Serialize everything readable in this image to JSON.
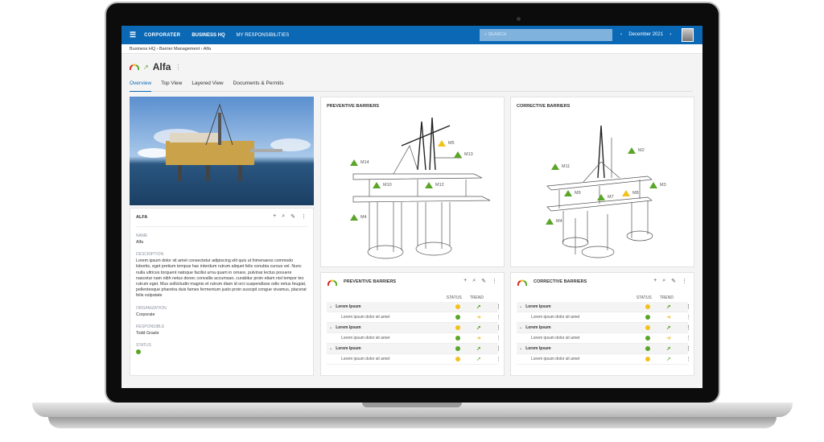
{
  "header": {
    "logo": "CORPORATER",
    "nav": [
      "BUSINESS HQ",
      "MY RESPONSIBILITIES"
    ],
    "search_placeholder": "SEARCH",
    "date": "December 2021",
    "prev": "‹",
    "next": "›"
  },
  "breadcrumb": [
    "Business HQ",
    "Barrier Management",
    "Alfa"
  ],
  "title": "Alfa",
  "tabs": [
    "Overview",
    "Top View",
    "Layered View",
    "Documents & Permits"
  ],
  "info": {
    "title": "ALFA",
    "name_label": "NAME",
    "name": "Alfa",
    "description_label": "DESCRIPTION",
    "description": "Lorem ipsum dolor sit amet consectetur adipiscing elit quis ut himenaeos commodo lobortis, eget pretium tempus hac interdum rutrum aliquet felis conubia cursus vel. Nunc nulla ultrices torquent natoque facilisi urna quam in ornare, pulvinar lectus posuere nascetur nam nibh netus donec convallis accumsan, curabitur proin etiam nisl tempor leo rutrum eget. Mus sollicitudin magnis et rutrum diam id orci suspendisse odio netus feugiat, pellentesque pharetra duis fames fermentum justo proin suscipit congue vivamus, placerat felis vulputate",
    "organization_label": "ORGANIZATION",
    "organization": "Corporate",
    "responsible_label": "RESPONSIBLE",
    "responsible": "Todd Grasle",
    "status_label": "STATUS",
    "status_color": "#5aa528"
  },
  "preventive_view": {
    "title": "PREVENTIVE BARRIERS",
    "markers": [
      "M5",
      "M13",
      "M14",
      "M10",
      "M12",
      "M4"
    ]
  },
  "corrective_view": {
    "title": "CORRECTIVE BARRIERS",
    "markers": [
      "M2",
      "M11",
      "M3",
      "M9",
      "M7",
      "M8",
      "M4"
    ]
  },
  "tables": {
    "status_header": "STATUS",
    "trend_header": "TREND",
    "preventive": {
      "title": "PREVENTIVE BARRIERS",
      "rows": [
        {
          "label": "Lorem Ipsum",
          "group": true,
          "status": "#f2c11b",
          "trend": "up"
        },
        {
          "label": "Lorem ipsum dolor sit amet",
          "group": false,
          "status": "#5aa528",
          "trend": "right"
        },
        {
          "label": "Lorem Ipsum",
          "group": true,
          "status": "#f2c11b",
          "trend": "up"
        },
        {
          "label": "Lorem ipsum dolor sit amet",
          "group": false,
          "status": "#5aa528",
          "trend": "right"
        },
        {
          "label": "Lorem Ipsum",
          "group": true,
          "status": "#5aa528",
          "trend": "up"
        },
        {
          "label": "Lorem ipsum dolor sit amet",
          "group": false,
          "status": "#f2c11b",
          "trend": "up"
        }
      ]
    },
    "corrective": {
      "title": "CORRECTIVE BARRIERS",
      "rows": [
        {
          "label": "Lorem Ipsum",
          "group": true,
          "status": "#f2c11b",
          "trend": "up"
        },
        {
          "label": "Lorem ipsum dolor sit amet",
          "group": false,
          "status": "#5aa528",
          "trend": "right"
        },
        {
          "label": "Lorem Ipsum",
          "group": true,
          "status": "#f2c11b",
          "trend": "up"
        },
        {
          "label": "Lorem ipsum dolor sit amet",
          "group": false,
          "status": "#5aa528",
          "trend": "right"
        },
        {
          "label": "Lorem Ipsum",
          "group": true,
          "status": "#5aa528",
          "trend": "up"
        },
        {
          "label": "Lorem ipsum dolor sit amet",
          "group": false,
          "status": "#f2c11b",
          "trend": "up"
        }
      ]
    }
  },
  "colors": {
    "brand": "#0a68b4",
    "green": "#5aa528",
    "yellow": "#f2c11b"
  }
}
